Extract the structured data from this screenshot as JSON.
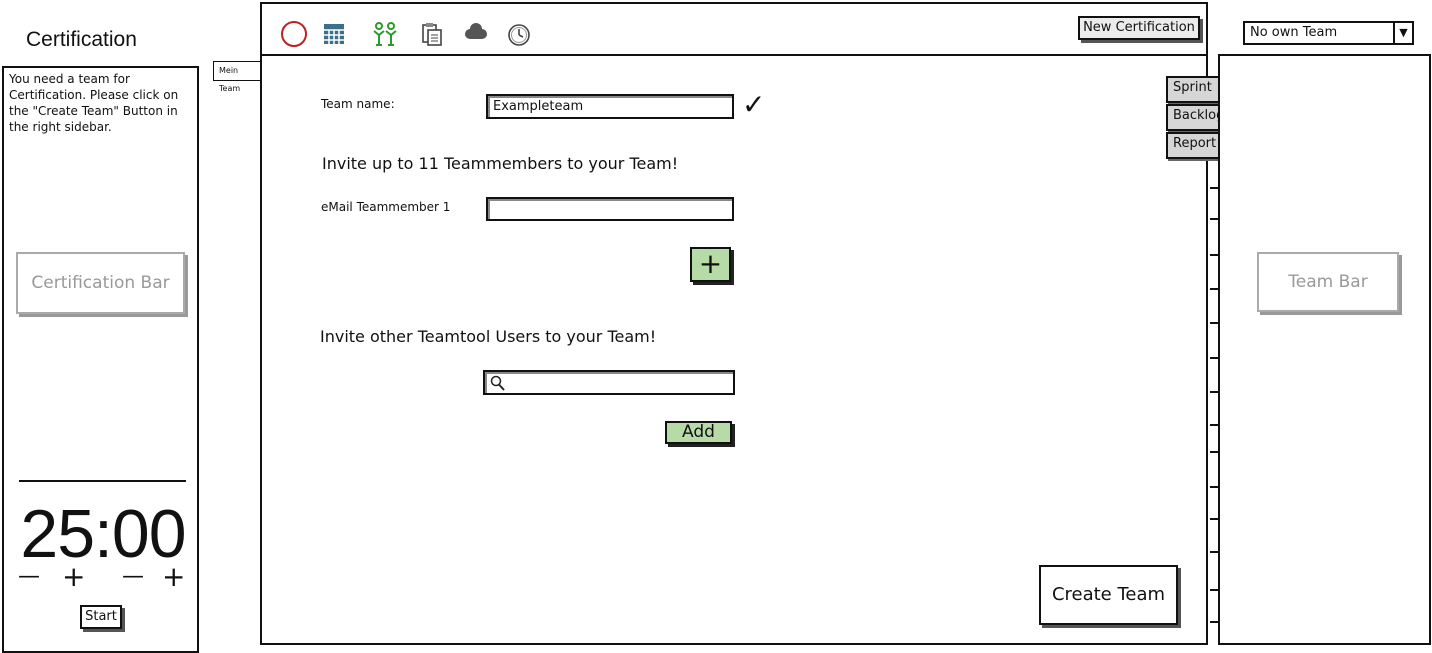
{
  "left_panel": {
    "title": "Certification",
    "message": "You need a team for Certification. Please click on the \"Create Team\" Button in the right sidebar.",
    "bar_label": "Certification Bar",
    "timer": {
      "time": "25:00",
      "minus": "—",
      "plus": "+",
      "start_label": "Start"
    }
  },
  "toolbar": {
    "icons": [
      "circle-icon",
      "calendar-icon",
      "team-icon",
      "clipboard-icon",
      "cloud-icon",
      "clock-icon"
    ],
    "new_certification_label": "New Certification"
  },
  "tab": {
    "label": "Mein Team"
  },
  "side_tabs": [
    "Sprint",
    "Backlog",
    "Report"
  ],
  "form": {
    "team_name_label": "Team name:",
    "team_name_value": "Exampleteam",
    "check_mark": "✓",
    "invite_heading": "Invite up to 11 Teammembers to your Team!",
    "email_label": "eMail Teammember 1",
    "email_value": "",
    "add_field_label": "+",
    "invite_users_heading": "Invite other Teamtool Users to your Team!",
    "search_value": "",
    "add_label": "Add",
    "create_team_label": "Create Team"
  },
  "right_panel": {
    "team_select_value": "No own Team",
    "bar_label": "Team Bar"
  }
}
